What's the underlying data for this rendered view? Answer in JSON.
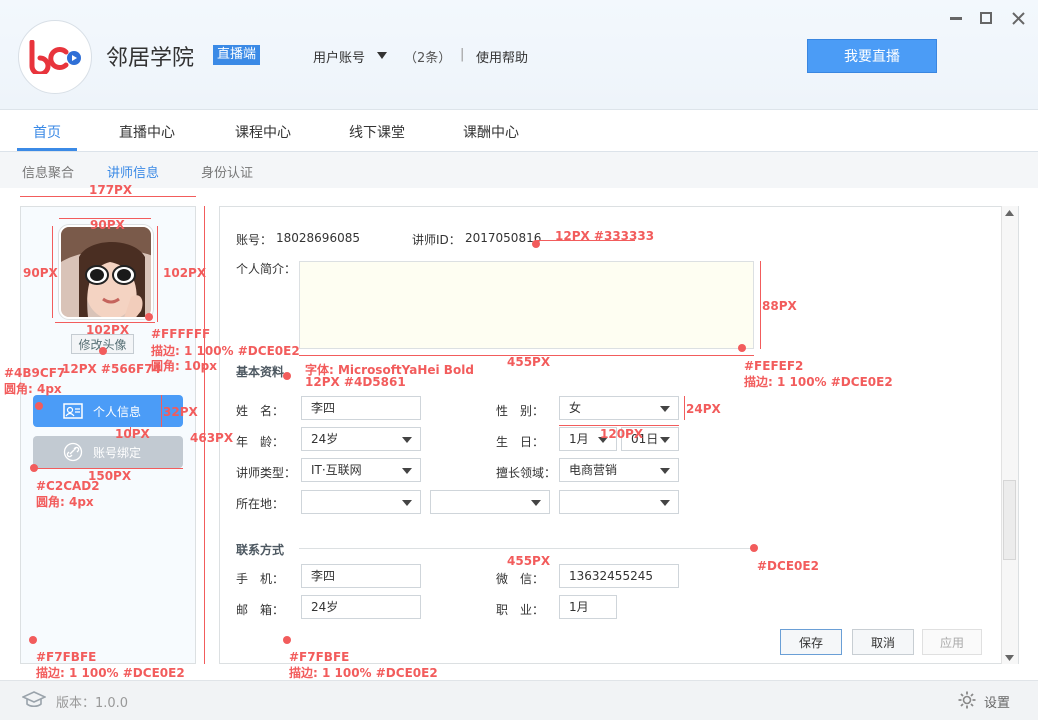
{
  "app": {
    "name": "邻居学院",
    "badge": "直播端",
    "account_label": "用户账号",
    "count": "（2条）",
    "separator": "|",
    "help": "使用帮助",
    "live_button": "我要直播"
  },
  "nav": {
    "tabs": [
      "首页",
      "直播中心",
      "课程中心",
      "线下课堂",
      "课酬中心"
    ],
    "active": 0
  },
  "subnav": {
    "tabs": [
      "信息聚合",
      "讲师信息",
      "身份认证"
    ],
    "active": 1
  },
  "sidebar": {
    "change_avatar": "修改头像",
    "items": [
      {
        "label": "个人信息",
        "icon": "id-card-icon"
      },
      {
        "label": "账号绑定",
        "icon": "link-icon"
      }
    ]
  },
  "form": {
    "account_label": "账号：",
    "account_value": "18028696085",
    "teacher_id_label": "讲师ID：",
    "teacher_id_value": "2017050816",
    "intro_label": "个人简介：",
    "basic_section": "基本资料",
    "name_label": "姓　名：",
    "name_value": "李四",
    "gender_label": "性　别：",
    "gender_value": "女",
    "age_label": "年　龄：",
    "age_value": "24岁",
    "birthday_label": "生　日：",
    "birth_month": "1月",
    "birth_day": "01日",
    "type_label": "讲师类型：",
    "type_value": "IT·互联网",
    "field_label": "擅长领域：",
    "field_value": "电商营销",
    "location_label": "所在地：",
    "contact_section": "联系方式",
    "phone_label": "手　机：",
    "phone_value": "李四",
    "wechat_label": "微　信：",
    "wechat_value": "13632455245",
    "email_label": "邮　箱：",
    "email_value": "24岁",
    "job_label": "职　业：",
    "job_value": "1月"
  },
  "buttons": {
    "save": "保存",
    "cancel": "取消",
    "apply": "应用"
  },
  "footer": {
    "version": "版本：1.0.0",
    "settings": "设置"
  },
  "annotations": {
    "a177": "177PX",
    "a90w": "90PX",
    "a90h": "90PX",
    "a102h": "102PX",
    "a102w": "102PX",
    "avatar_color": "#FFFFFF",
    "avatar_border": "描边: 1 100% #DCE0E2",
    "avatar_radius": "圆角: 10px",
    "btn_font": "12PX #566F74",
    "active_color": "#4B9CF7",
    "active_radius": "圆角: 4px",
    "a32": "32PX",
    "a10": "10PX",
    "a463": "463PX",
    "a150": "150PX",
    "inactive_color": "#C2CAD2",
    "inactive_radius": "圆角: 4px",
    "left_bg": "#F7FBFE",
    "left_border": "描边: 1 100% #DCE0E2",
    "main_bg": "#F7FBFE",
    "main_border": "描边: 1 100% #DCE0E2",
    "font_12": "12PX #333333",
    "a88": "88PX",
    "a455": "455PX",
    "intro_bg": "#FEFEF2",
    "intro_border": "描边: 1 100% #DCE0E2",
    "section_font": "字体: MicrosoftYaHei Bold",
    "section_color": "12PX #4D5861",
    "a24": "24PX",
    "a120": "120PX",
    "a455b": "455PX",
    "line_color": "#DCE0E2"
  },
  "colors": {
    "accent": "#4B9CF7",
    "annotation": "#F25C5C",
    "inactive": "#C2CAD2"
  }
}
